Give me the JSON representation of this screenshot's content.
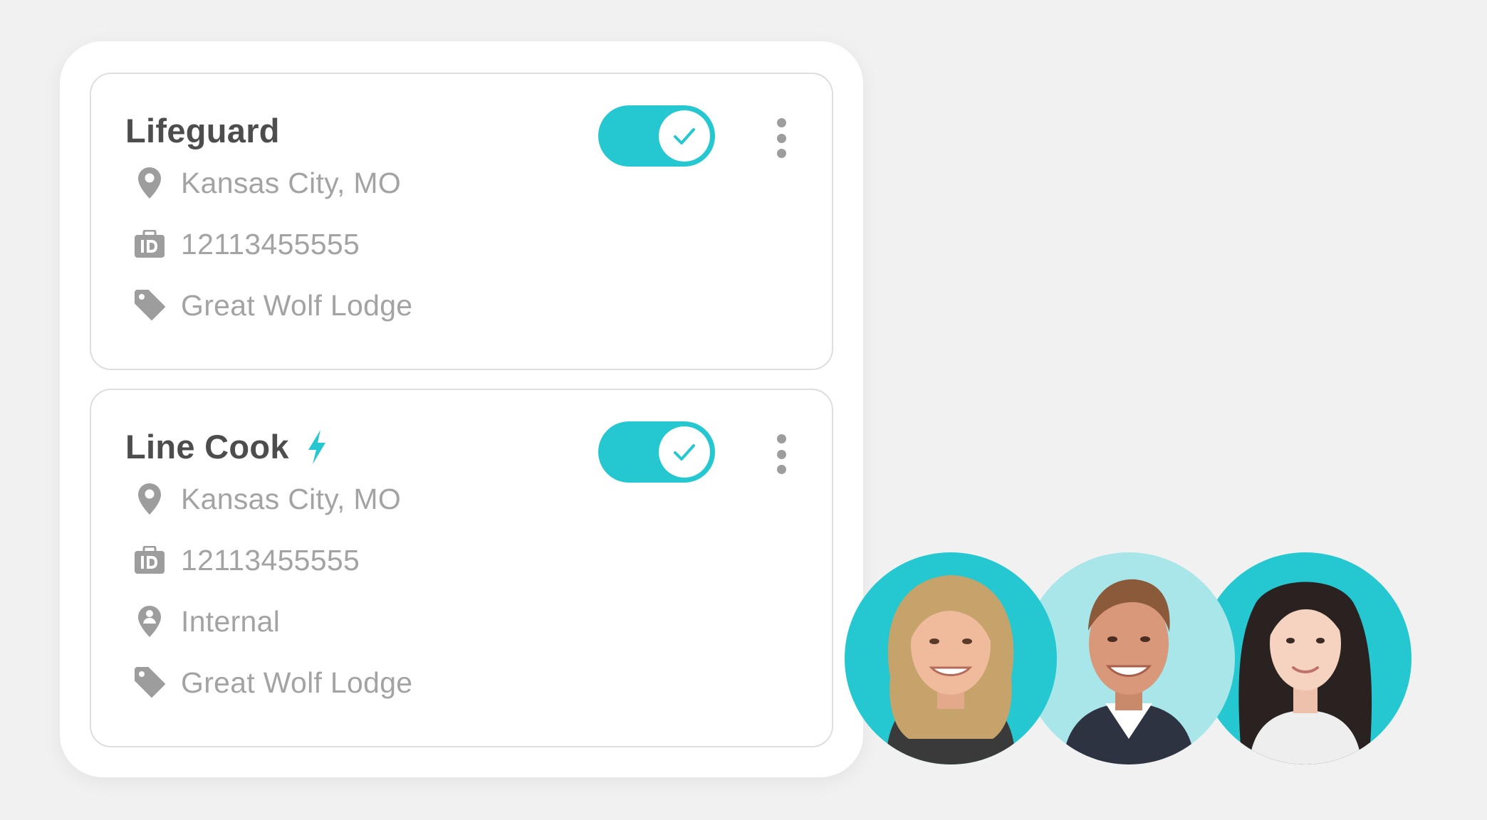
{
  "jobs": [
    {
      "title": "Lifeguard",
      "featured": false,
      "enabled": true,
      "location": "Kansas City, MO",
      "job_id": "12113455555",
      "category": "Great Wolf Lodge"
    },
    {
      "title": "Line Cook",
      "featured": true,
      "enabled": true,
      "location": "Kansas City, MO",
      "job_id": "12113455555",
      "type": "Internal",
      "category": "Great Wolf Lodge"
    }
  ],
  "icons": {
    "location": "map-pin-icon",
    "id": "id-badge-icon",
    "internal": "person-pin-icon",
    "category": "tag-icon",
    "featured": "lightning-bolt-icon",
    "toggle_on": "checkmark-icon",
    "menu": "kebab-menu-icon"
  },
  "colors": {
    "accent": "#25c8d0",
    "accent_light": "#a8e6ea",
    "title_text": "#4d4d4d",
    "detail_text": "#a3a3a3",
    "icon": "#9d9d9d",
    "background": "#f1f1f1",
    "card_border": "#dedede"
  }
}
